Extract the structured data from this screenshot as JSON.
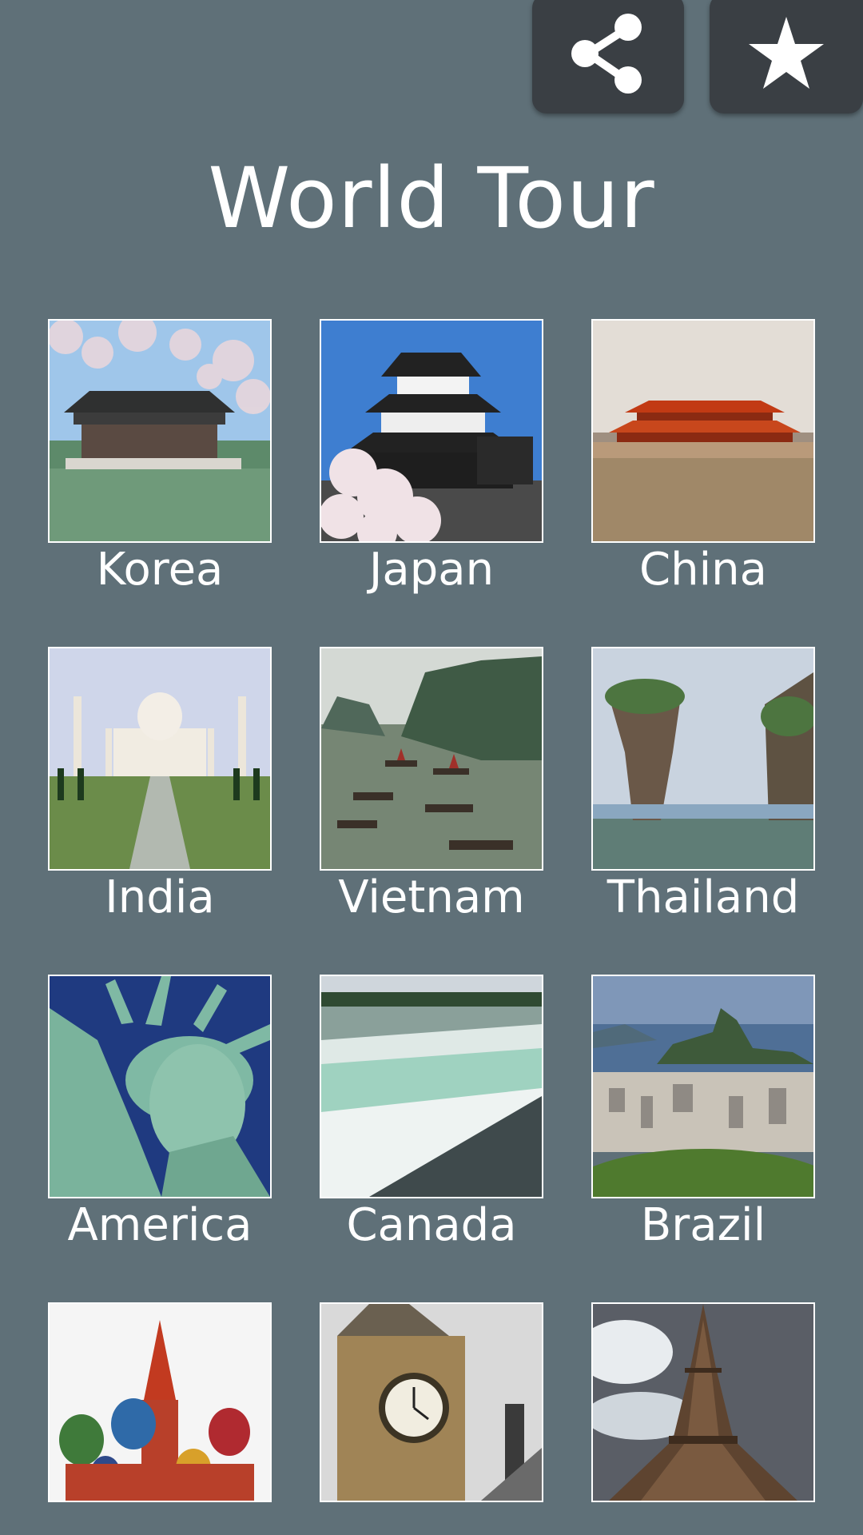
{
  "header": {
    "title": "World Tour",
    "share_icon": "share-icon",
    "favorite_icon": "star-icon"
  },
  "colors": {
    "background": "#5f7078",
    "button": "#3a3f44",
    "text": "#ffffff"
  },
  "destinations": [
    {
      "label": "Korea"
    },
    {
      "label": "Japan"
    },
    {
      "label": "China"
    },
    {
      "label": "India"
    },
    {
      "label": "Vietnam"
    },
    {
      "label": "Thailand"
    },
    {
      "label": "America"
    },
    {
      "label": "Canada"
    },
    {
      "label": "Brazil"
    },
    {
      "label": ""
    },
    {
      "label": ""
    },
    {
      "label": ""
    }
  ]
}
